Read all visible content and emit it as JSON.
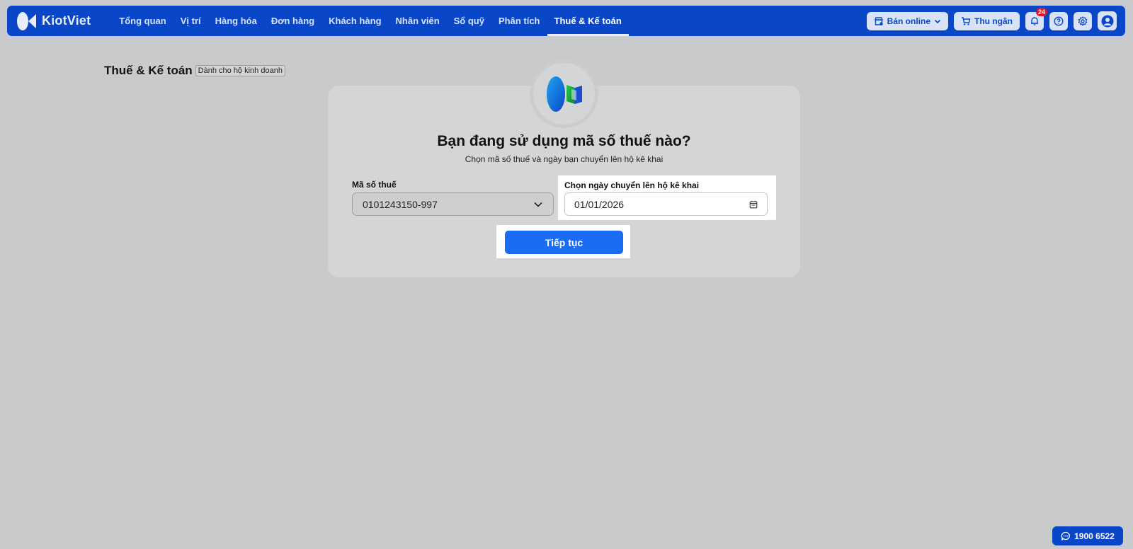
{
  "brand": {
    "name": "KiotViet"
  },
  "nav": {
    "items": [
      {
        "label": "Tổng quan",
        "active": false
      },
      {
        "label": "Vị trí",
        "active": false
      },
      {
        "label": "Hàng hóa",
        "active": false
      },
      {
        "label": "Đơn hàng",
        "active": false
      },
      {
        "label": "Khách hàng",
        "active": false
      },
      {
        "label": "Nhân viên",
        "active": false
      },
      {
        "label": "Sổ quỹ",
        "active": false
      },
      {
        "label": "Phân tích",
        "active": false
      },
      {
        "label": "Thuế & Kế toán",
        "active": true
      }
    ],
    "sell_online_label": "Bán online",
    "cashier_label": "Thu ngân",
    "notification_count": "24"
  },
  "page": {
    "title": "Thuế & Kế toán",
    "tag": "Dành cho hộ kinh doanh"
  },
  "card": {
    "heading": "Bạn đang sử dụng mã số thuế nào?",
    "subheading": "Chọn mã số thuế và ngày bạn chuyển lên hộ kê khai",
    "tax_label": "Mã số thuế",
    "tax_value": "0101243150-997",
    "date_label": "Chọn ngày chuyển lên hộ kê khai",
    "date_value": "01/01/2026",
    "continue_label": "Tiếp tục"
  },
  "hotline": {
    "label": "1900 6522"
  },
  "colors": {
    "brand_blue": "#0a47c8",
    "primary_button": "#1a6df2",
    "badge_red": "#e0162b"
  }
}
